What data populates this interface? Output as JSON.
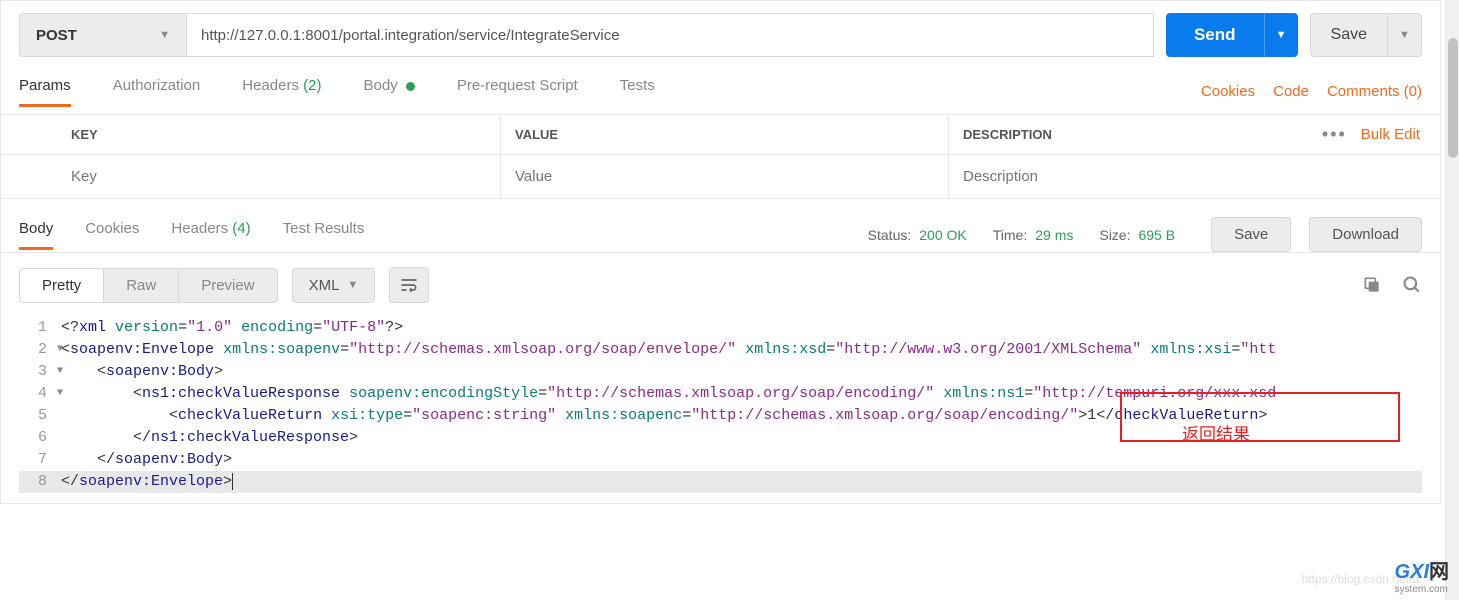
{
  "request": {
    "method": "POST",
    "url": "http://127.0.0.1:8001/portal.integration/service/IntegrateService",
    "send_label": "Send",
    "save_label": "Save"
  },
  "req_tabs": {
    "params": "Params",
    "authorization": "Authorization",
    "headers": "Headers",
    "headers_count": "(2)",
    "body": "Body",
    "prerequest": "Pre-request Script",
    "tests": "Tests"
  },
  "req_links": {
    "cookies": "Cookies",
    "code": "Code",
    "comments": "Comments (0)"
  },
  "params_table": {
    "key_header": "KEY",
    "value_header": "VALUE",
    "desc_header": "DESCRIPTION",
    "bulk_edit": "Bulk Edit",
    "key_placeholder": "Key",
    "value_placeholder": "Value",
    "desc_placeholder": "Description"
  },
  "res_tabs": {
    "body": "Body",
    "cookies": "Cookies",
    "headers": "Headers",
    "headers_count": "(4)",
    "test_results": "Test Results"
  },
  "status": {
    "status_label": "Status:",
    "status_value": "200 OK",
    "time_label": "Time:",
    "time_value": "29 ms",
    "size_label": "Size:",
    "size_value": "695 B",
    "save_label": "Save",
    "download_label": "Download"
  },
  "view": {
    "pretty": "Pretty",
    "raw": "Raw",
    "preview": "Preview",
    "format": "XML"
  },
  "code_lines": [
    {
      "n": 1,
      "fold": false,
      "html": "<span class='txt'>&lt;?</span><span class='tag'>xml</span> <span class='attr'>version</span>=<span class='str'>\"1.0\"</span> <span class='attr'>encoding</span>=<span class='str'>\"UTF-8\"</span><span class='txt'>?&gt;</span>"
    },
    {
      "n": 2,
      "fold": true,
      "html": "<span class='txt'>&lt;</span><span class='tag'>soapenv:Envelope</span> <span class='attr'>xmlns:soapenv</span>=<span class='str'>\"http://schemas.xmlsoap.org/soap/envelope/\"</span> <span class='attr'>xmlns:xsd</span>=<span class='str'>\"http://www.w3.org/2001/XMLSchema\"</span> <span class='attr'>xmlns:xsi</span>=<span class='str'>\"htt</span>"
    },
    {
      "n": 3,
      "fold": true,
      "html": "    <span class='txt'>&lt;</span><span class='tag'>soapenv:Body</span><span class='txt'>&gt;</span>"
    },
    {
      "n": 4,
      "fold": true,
      "html": "        <span class='txt'>&lt;</span><span class='tag'>ns1:checkValueResponse</span> <span class='attr'>soapenv:encodingStyle</span>=<span class='str'>\"http://schemas.xmlsoap.org/soap/encoding/\"</span> <span class='attr'>xmlns:ns1</span>=<span class='str'>\"http://tempuri.org/xxx.xsd</span>"
    },
    {
      "n": 5,
      "fold": false,
      "html": "            <span class='txt'>&lt;</span><span class='tag'>checkValueReturn</span> <span class='attr'>xsi:type</span>=<span class='str'>\"soapenc:string\"</span> <span class='attr'>xmlns:soapenc</span>=<span class='str'>\"http://schemas.xmlsoap.org/soap/encoding/\"</span><span class='txt'>&gt;1&lt;/</span><span class='tag'>checkValueReturn</span><span class='txt'>&gt;</span>"
    },
    {
      "n": 6,
      "fold": false,
      "html": "        <span class='txt'>&lt;/</span><span class='tag'>ns1:checkValueResponse</span><span class='txt'>&gt;</span>"
    },
    {
      "n": 7,
      "fold": false,
      "html": "    <span class='txt'>&lt;/</span><span class='tag'>soapenv:Body</span><span class='txt'>&gt;</span>"
    },
    {
      "n": 8,
      "fold": false,
      "hl": true,
      "html": "<span class='txt'>&lt;/</span><span class='tag'>soapenv:Envelope</span><span class='txt'>&gt;</span><span class='cursor'></span>"
    }
  ],
  "annotation_text": "返回结果",
  "watermark": {
    "brand": "GXI",
    "suffix": "网",
    "sub": "system.com"
  },
  "blog_watermark": "https://blog.csdn.net/q"
}
